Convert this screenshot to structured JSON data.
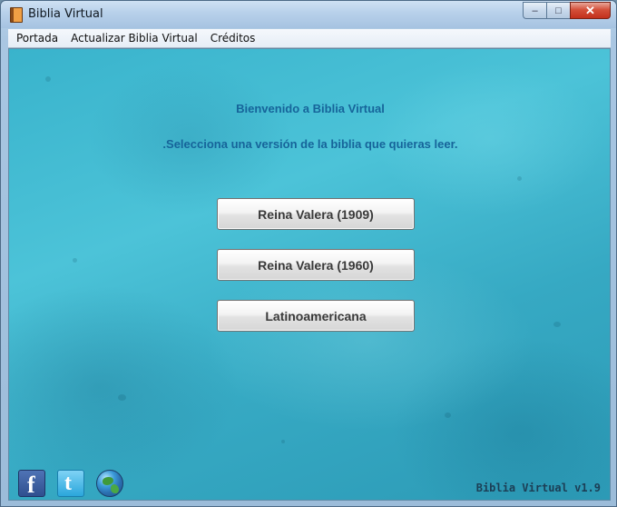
{
  "window": {
    "title": "Biblia Virtual",
    "buttons": {
      "minimize": "–",
      "maximize": "□",
      "close": "✕"
    }
  },
  "menu": {
    "items": [
      {
        "label": "Portada"
      },
      {
        "label": "Actualizar Biblia Virtual"
      },
      {
        "label": "Créditos"
      }
    ]
  },
  "main": {
    "welcome": "Bienvenido a Biblia Virtual",
    "instruction": ".Selecciona una versión de la biblia que quieras leer.",
    "versions": [
      {
        "label": "Reina Valera (1909)"
      },
      {
        "label": "Reina Valera (1960)"
      },
      {
        "label": "Latinoamericana"
      }
    ]
  },
  "footer": {
    "social": [
      {
        "icon": "facebook-icon",
        "glyph": "f"
      },
      {
        "icon": "twitter-icon",
        "glyph": "t"
      },
      {
        "icon": "globe-icon"
      }
    ],
    "version": "Biblia Virtual v1.9"
  },
  "colors": {
    "background": "#3fb6cd",
    "heading_text": "#16649a",
    "close_button": "#c2301c"
  }
}
